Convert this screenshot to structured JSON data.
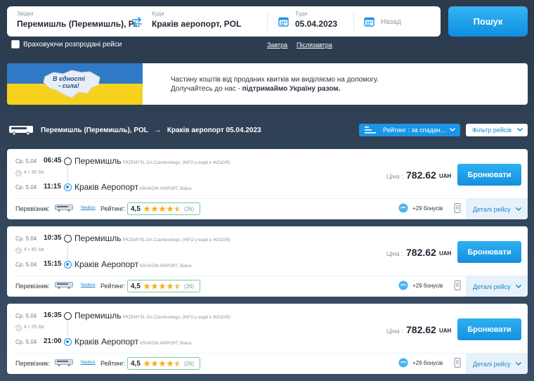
{
  "search": {
    "from_label": "Звідки",
    "from_value": "Перемишль (Перемишль), P...",
    "to_label": "Куди",
    "to_value": "Краків аеропорт, POL",
    "date_label": "Туди",
    "date_value": "05.04.2023",
    "return_placeholder": "Назад",
    "search_button": "Пошук",
    "sold_out_label": "Враховуючи розпродані рейси",
    "tomorrow_link": "Завтра",
    "day_after_link": "Післязавтра"
  },
  "banner": {
    "slogan_line1": "В єдності",
    "slogan_line2": "- сила!",
    "text_line1": "Частину коштів від проданих квитків ми виділяємо на допомогу.",
    "text_line2_prefix": "Долучайтесь до нас -",
    "text_line2_bold": "підтримаймо Україну разом."
  },
  "route": {
    "from": "Перемишль (Перемишль), POL",
    "arrow": "→",
    "to": "Краків аеропорт 05.04.2023",
    "sort_label": "Рейтинг : за спадан...",
    "filter_label": "Фільтр рейсів"
  },
  "trips": [
    {
      "dep_date": "Ср. 5.04",
      "dep_time": "06:45",
      "duration": "4 г 30 Хв",
      "arr_date": "Ср. 5.04",
      "arr_time": "11:15",
      "dep_city": "Перемишль",
      "dep_stop": "PRZEMYŚL DA Czarnieckiego, (INFO у водія в ЖЕШУВ)",
      "arr_city": "Краків Аеропорт",
      "arr_stop": "KRAKÓW AIRPORT, Balice",
      "price_label": "Ціна :",
      "price": "782.62",
      "currency": "UAH",
      "book": "Бронювати",
      "carrier_label": "Перевізник:",
      "carrier": "Neobus",
      "rating_label": "Рейтинг:",
      "rating": "4,5",
      "rating_count": "(26)",
      "bonus": "+29 бонусів",
      "details": "Деталі рейсу"
    },
    {
      "dep_date": "Ср. 5.04",
      "dep_time": "10:35",
      "duration": "4 г 40 Хв",
      "arr_date": "Ср. 5.04",
      "arr_time": "15:15",
      "dep_city": "Перемишль",
      "dep_stop": "PRZEMYŚL DA Czarnieckiego, (INFO у водія в ЖЕШУВ)",
      "arr_city": "Краків Аеропорт",
      "arr_stop": "KRAKÓW AIRPORT, Balice",
      "price_label": "Ціна :",
      "price": "782.62",
      "currency": "UAH",
      "book": "Бронювати",
      "carrier_label": "Перевізник:",
      "carrier": "Neobus",
      "rating_label": "Рейтинг:",
      "rating": "4,5",
      "rating_count": "(26)",
      "bonus": "+29 бонусів",
      "details": "Деталі рейсу"
    },
    {
      "dep_date": "Ср. 5.04",
      "dep_time": "16:35",
      "duration": "4 г 25 Хв",
      "arr_date": "Ср. 5.04",
      "arr_time": "21:00",
      "dep_city": "Перемишль",
      "dep_stop": "PRZEMYŚL DA Czarnieckiego, (INFO у водія в ЖЕШУВ)",
      "arr_city": "Краків Аеропорт",
      "arr_stop": "KRAKÓW AIRPORT, Balice",
      "price_label": "Ціна :",
      "price": "782.62",
      "currency": "UAH",
      "book": "Бронювати",
      "carrier_label": "Перевізник:",
      "carrier": "Neobus",
      "rating_label": "Рейтинг:",
      "rating": "4,5",
      "rating_count": "(26)",
      "bonus": "+29 бонусів",
      "details": "Деталі рейсу"
    }
  ],
  "colors": {
    "accent": "#1a96e6",
    "star": "#f5b21b",
    "rating_border": "#6fcf97",
    "flag_blue": "#2f79c6",
    "flag_yellow": "#f7d21c"
  }
}
